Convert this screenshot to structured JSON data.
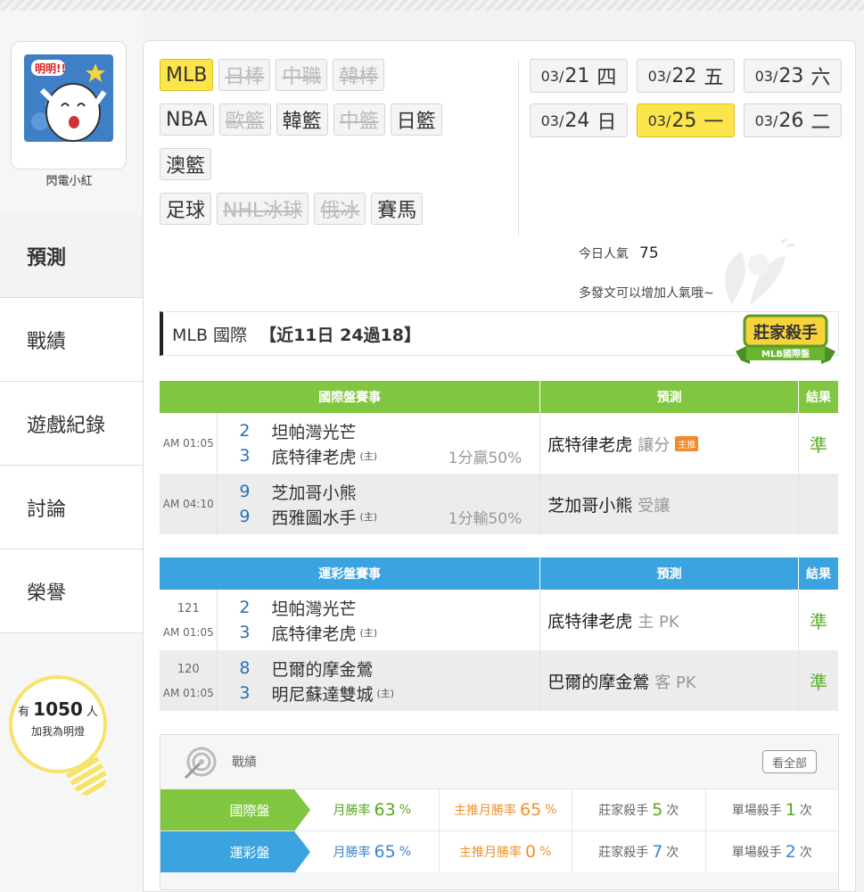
{
  "user": {
    "name": "閃電小紅",
    "avatar_text": "明明!!"
  },
  "menu": [
    {
      "label": "預測"
    },
    {
      "label": "戰績"
    },
    {
      "label": "遊戲紀錄"
    },
    {
      "label": "討論"
    },
    {
      "label": "榮譽"
    }
  ],
  "fans": {
    "prefix": "有",
    "count": "1050",
    "suffix": "人",
    "action": "加我為明燈"
  },
  "filters": {
    "row1": [
      {
        "label": "MLB",
        "state": "selected"
      },
      {
        "label": "日棒",
        "state": "disabled"
      },
      {
        "label": "中職",
        "state": "disabled"
      },
      {
        "label": "韓棒",
        "state": "disabled"
      }
    ],
    "row2": [
      {
        "label": "NBA",
        "state": "normal"
      },
      {
        "label": "歐籃",
        "state": "disabled"
      },
      {
        "label": "韓籃",
        "state": "normal"
      },
      {
        "label": "中籃",
        "state": "disabled"
      },
      {
        "label": "日籃",
        "state": "normal"
      }
    ],
    "row3": [
      {
        "label": "澳籃",
        "state": "normal"
      }
    ],
    "row4": [
      {
        "label": "足球",
        "state": "normal"
      },
      {
        "label": "NHL冰球",
        "state": "disabled"
      },
      {
        "label": "俄冰",
        "state": "disabled"
      },
      {
        "label": "賽馬",
        "state": "normal"
      }
    ]
  },
  "dates": [
    {
      "md": "03/",
      "d": "21",
      "w": "四"
    },
    {
      "md": "03/",
      "d": "22",
      "w": "五"
    },
    {
      "md": "03/",
      "d": "23",
      "w": "六"
    },
    {
      "md": "03/",
      "d": "24",
      "w": "日"
    },
    {
      "md": "03/",
      "d": "25",
      "w": "一",
      "selected": true
    },
    {
      "md": "03/",
      "d": "26",
      "w": "二"
    }
  ],
  "popularity": {
    "label": "今日人氣",
    "value": "75",
    "hint": "多發文可以增加人氣哦~"
  },
  "section": {
    "title": "MLB 國際",
    "record": "【近11日 24過18】",
    "badge_main": "莊家殺手",
    "badge_sub": "MLB國際盤"
  },
  "intl_table": {
    "headers": [
      "國際盤賽事",
      "預測",
      "結果"
    ],
    "rows": [
      {
        "time": "AM 01:05",
        "num": "",
        "away": {
          "score": "2",
          "team": "坦帕灣光芒"
        },
        "home": {
          "score": "3",
          "team": "底特律老虎",
          "mark": "(主)"
        },
        "handicap": "1分贏50%",
        "pick": "底特律老虎",
        "ptype": "讓分",
        "tag": "主推",
        "result": "準"
      },
      {
        "time": "AM 04:10",
        "num": "",
        "away": {
          "score": "9",
          "team": "芝加哥小熊"
        },
        "home": {
          "score": "9",
          "team": "西雅圖水手",
          "mark": "(主)"
        },
        "handicap": "1分輸50%",
        "pick": "芝加哥小熊",
        "ptype": "受讓",
        "tag": "",
        "result": ""
      }
    ]
  },
  "lottery_table": {
    "headers": [
      "運彩盤賽事",
      "預測",
      "結果"
    ],
    "rows": [
      {
        "time": "AM 01:05",
        "num": "121",
        "away": {
          "score": "2",
          "team": "坦帕灣光芒"
        },
        "home": {
          "score": "3",
          "team": "底特律老虎",
          "mark": "(主)"
        },
        "handicap": "",
        "pick": "底特律老虎",
        "ptype": "主 PK",
        "tag": "",
        "result": "準"
      },
      {
        "time": "AM 01:05",
        "num": "120",
        "away": {
          "score": "8",
          "team": "巴爾的摩金鶯"
        },
        "home": {
          "score": "3",
          "team": "明尼蘇達雙城",
          "mark": "(主)"
        },
        "handicap": "",
        "pick": "巴爾的摩金鶯",
        "ptype": "客 PK",
        "tag": "",
        "result": "準"
      }
    ]
  },
  "stats": {
    "title": "戰績",
    "view_all": "看全部",
    "rows": [
      {
        "label": "國際盤",
        "color": "green",
        "month_label": "月勝率",
        "month": "63",
        "top_label": "主推月勝率",
        "top": "65",
        "pct": "%",
        "killer_label": "莊家殺手",
        "killer": "5",
        "single_label": "單場殺手",
        "single": "1",
        "times": "次"
      },
      {
        "label": "運彩盤",
        "color": "blue",
        "month_label": "月勝率",
        "month": "65",
        "top_label": "主推月勝率",
        "top": "0",
        "pct": "%",
        "killer_label": "莊家殺手",
        "killer": "7",
        "single_label": "單場殺手",
        "single": "2",
        "times": "次"
      }
    ]
  },
  "colors": {
    "green": "#80c640",
    "blue": "#3aa3e0",
    "yellow": "#fbe54b"
  }
}
